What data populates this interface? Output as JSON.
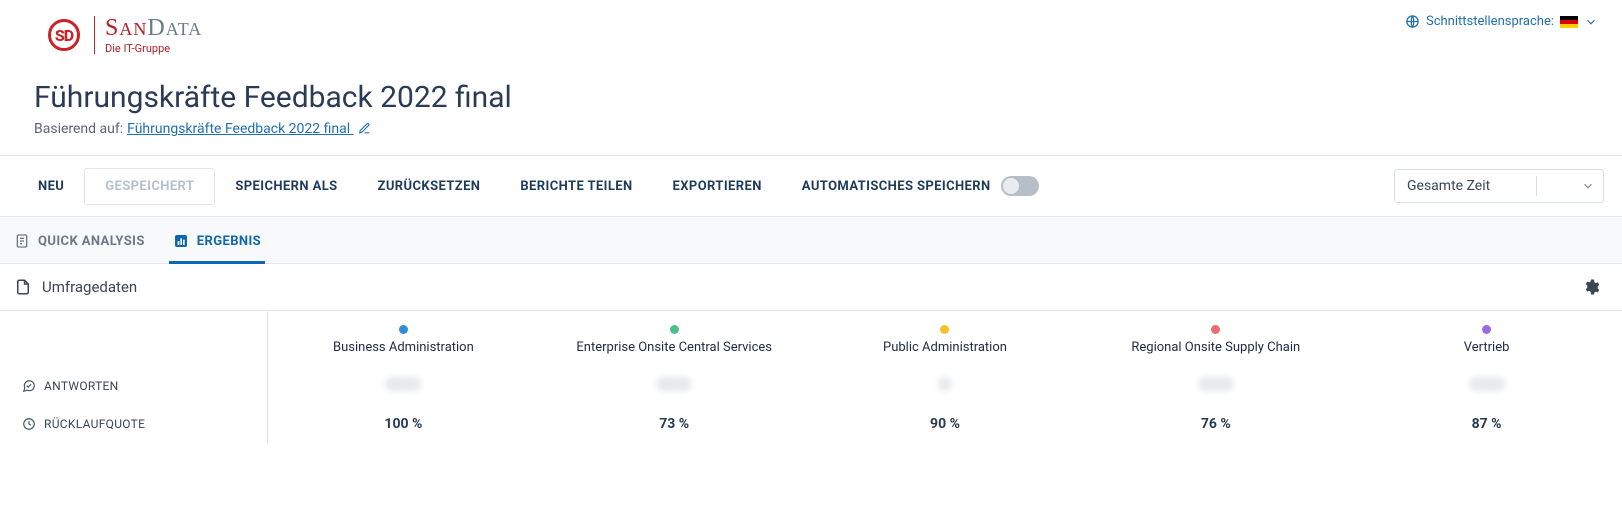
{
  "brand": {
    "mark": "SD",
    "name_a": "S",
    "name_b": "AN",
    "name_c": "D",
    "name_d": "ATA",
    "tagline": "Die IT-Gruppe"
  },
  "lang_switch": {
    "label": "Schnittstellensprache:"
  },
  "page": {
    "title": "Führungskräfte Feedback 2022 final",
    "based_on_prefix": "Basierend auf:",
    "based_on_link": "Führungskräfte Feedback 2022 final"
  },
  "toolbar": {
    "new": "NEU",
    "saved": "GESPEICHERT",
    "save_as": "SPEICHERN ALS",
    "reset": "ZURÜCKSETZEN",
    "share": "BERICHTE TEILEN",
    "export": "EXPORTIEREN",
    "autosave": "AUTOMATISCHES SPEICHERN",
    "time_filter": "Gesamte Zeit"
  },
  "tabs": {
    "quick": "QUICK ANALYSIS",
    "result": "ERGEBNIS"
  },
  "section": {
    "title": "Umfragedaten"
  },
  "rows": {
    "antworten": "ANTWORTEN",
    "ruecklauf": "RÜCKLAUFQUOTE"
  },
  "columns": [
    {
      "name": "Business Administration",
      "color": "#2e8fd8",
      "rate": "100 %",
      "blur": "wide"
    },
    {
      "name": "Enterprise Onsite Central Services",
      "color": "#4dbf8b",
      "rate": "73 %",
      "blur": "wide"
    },
    {
      "name": "Public Administration",
      "color": "#f3c22b",
      "rate": "90 %",
      "blur": "small"
    },
    {
      "name": "Regional Onsite Supply Chain",
      "color": "#ef6b72",
      "rate": "76 %",
      "blur": "wide"
    },
    {
      "name": "Vertrieb",
      "color": "#9a6bdc",
      "rate": "87 %",
      "blur": "wide"
    }
  ]
}
